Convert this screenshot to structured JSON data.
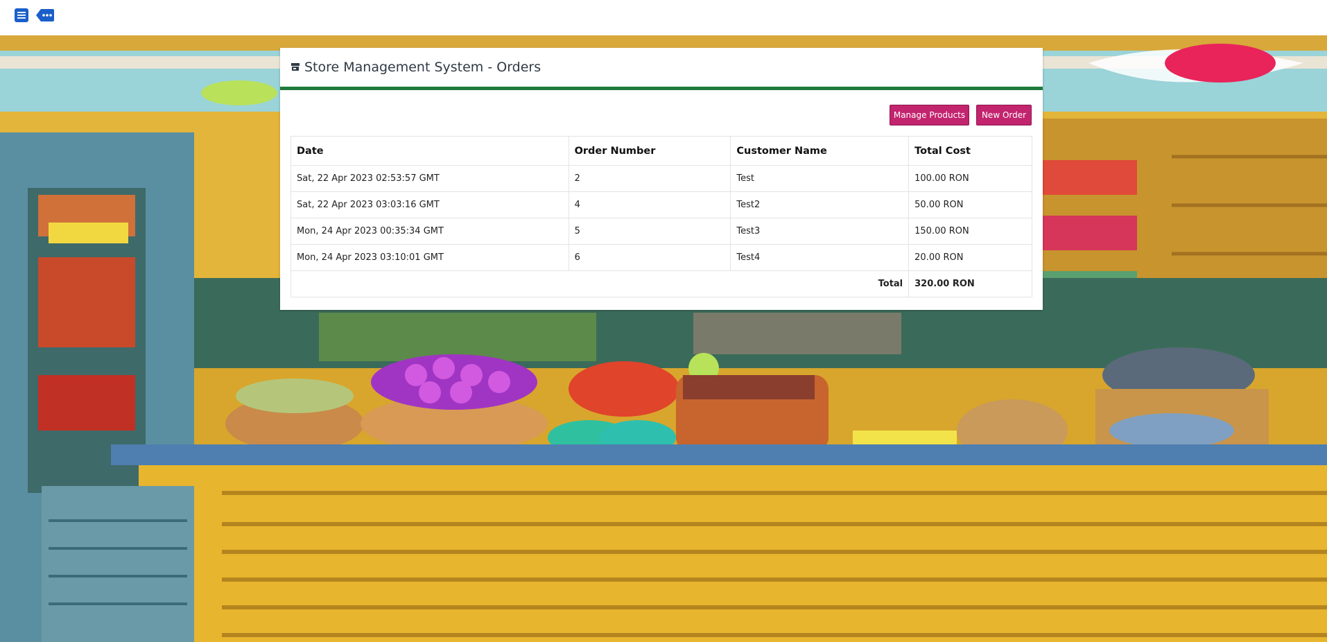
{
  "header": {
    "icons": [
      "list-icon",
      "more-tag-icon"
    ]
  },
  "card": {
    "title": "Store Management System - Orders",
    "title_icon": "store-icon",
    "accent_color": "#1f7a3c"
  },
  "toolbar": {
    "manage_products_label": "Manage Products",
    "new_order_label": "New Order",
    "button_color": "#c2246e"
  },
  "table": {
    "columns": [
      "Date",
      "Order Number",
      "Customer Name",
      "Total Cost"
    ],
    "rows": [
      [
        "Sat, 22 Apr 2023 02:53:57 GMT",
        "2",
        "Test",
        "100.00 RON"
      ],
      [
        "Sat, 22 Apr 2023 03:03:16 GMT",
        "4",
        "Test2",
        "50.00 RON"
      ],
      [
        "Mon, 24 Apr 2023 00:35:34 GMT",
        "5",
        "Test3",
        "150.00 RON"
      ],
      [
        "Mon, 24 Apr 2023 03:10:01 GMT",
        "6",
        "Test4",
        "20.00 RON"
      ]
    ],
    "total_label": "Total",
    "total_value": "320.00 RON"
  }
}
